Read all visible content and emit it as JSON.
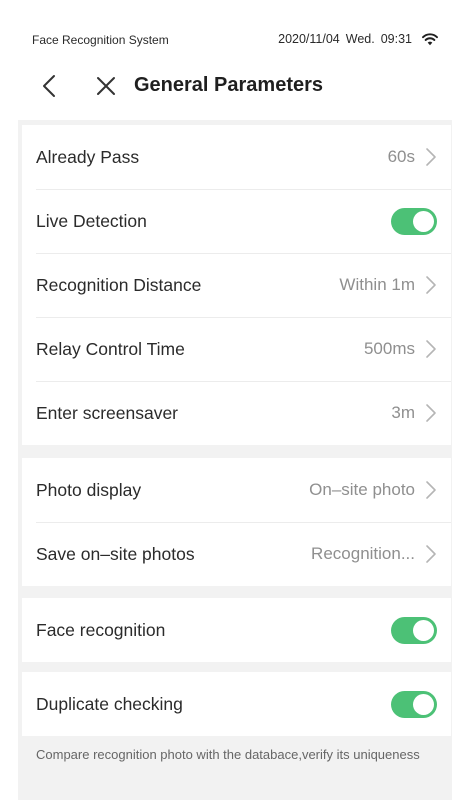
{
  "status_bar": {
    "app_name": "Face Recognition System",
    "date": "2020/11/04",
    "weekday": "Wed.",
    "time": "09:31",
    "wifi_icon": "wifi-icon"
  },
  "header": {
    "title": "General Parameters",
    "back_icon": "chevron-left-icon",
    "close_icon": "close-icon"
  },
  "colors": {
    "toggle_on": "#4cc176",
    "background": "#f2f2f2",
    "value_text": "#8f8f8f"
  },
  "group1": {
    "already_pass": {
      "label": "Already Pass",
      "value": "60s"
    },
    "live_detection": {
      "label": "Live Detection",
      "enabled": true
    },
    "recognition_distance": {
      "label": "Recognition Distance",
      "value": "Within 1m"
    },
    "relay_control_time": {
      "label": "Relay Control Time",
      "value": "500ms"
    },
    "enter_screensaver": {
      "label": "Enter screensaver",
      "value": "3m"
    }
  },
  "group2": {
    "photo_display": {
      "label": "Photo display",
      "value": "On–site photo"
    },
    "save_onsite_photos": {
      "label": "Save on–site photos",
      "value": "Recognition..."
    }
  },
  "group3": {
    "face_recognition": {
      "label": "Face recognition",
      "enabled": true
    }
  },
  "group4": {
    "duplicate_checking": {
      "label": "Duplicate checking",
      "enabled": true
    },
    "hint": "Compare recognition photo with the databace,verify its uniqueness"
  }
}
